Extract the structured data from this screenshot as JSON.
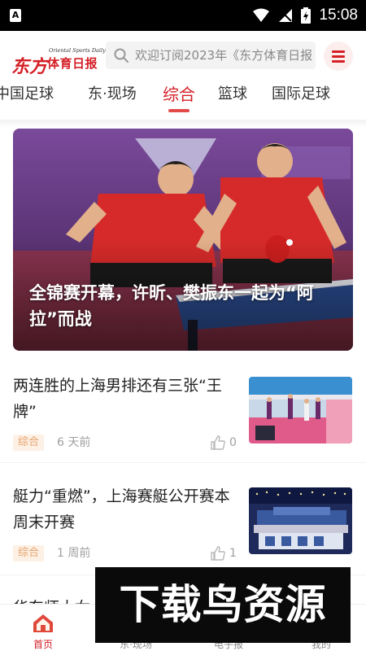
{
  "status_bar": {
    "time": "15:08",
    "notification_glyph": "A",
    "icons": [
      "wifi-icon",
      "signal-icon",
      "battery-charging-icon"
    ]
  },
  "header": {
    "logo_en": "Oriental Sports Daily",
    "logo_cn_part1": "东方",
    "logo_cn_part2": "体育日报",
    "search_placeholder": "欢迎订阅2023年《东方体育日报",
    "menu_icon": "hamburger-menu-icon"
  },
  "tabs": [
    {
      "label": "中国足球",
      "active": false
    },
    {
      "label": "东·现场",
      "active": false
    },
    {
      "label": "综合",
      "active": true
    },
    {
      "label": "篮球",
      "active": false
    },
    {
      "label": "国际足球",
      "active": false
    }
  ],
  "hero": {
    "title": "全锦赛开幕，许昕、樊振东一起为“阿拉”而战"
  },
  "news": [
    {
      "title": "两连胜的上海男排还有三张“王牌”",
      "tag": "综合",
      "time": "6 天前",
      "likes": "0"
    },
    {
      "title": "艇力“重燃”，上海赛艇公开赛本周末开赛",
      "tag": "综合",
      "time": "1 周前",
      "likes": "1"
    }
  ],
  "peek_text": "华东师大女...",
  "bottom_nav": [
    {
      "label": "首页",
      "icon": "home-icon",
      "active": true
    },
    {
      "label": "东·现场",
      "icon": "video-icon",
      "active": false
    },
    {
      "label": "电子报",
      "icon": "newspaper-icon",
      "active": false
    },
    {
      "label": "我的",
      "icon": "user-icon",
      "active": false
    }
  ],
  "watermark": "下载鸟资源",
  "colors": {
    "brand_red": "#d41f26",
    "tag_bg": "#fdf0e4",
    "tag_text": "#e6a46e",
    "muted_text": "#a0a0a0"
  }
}
